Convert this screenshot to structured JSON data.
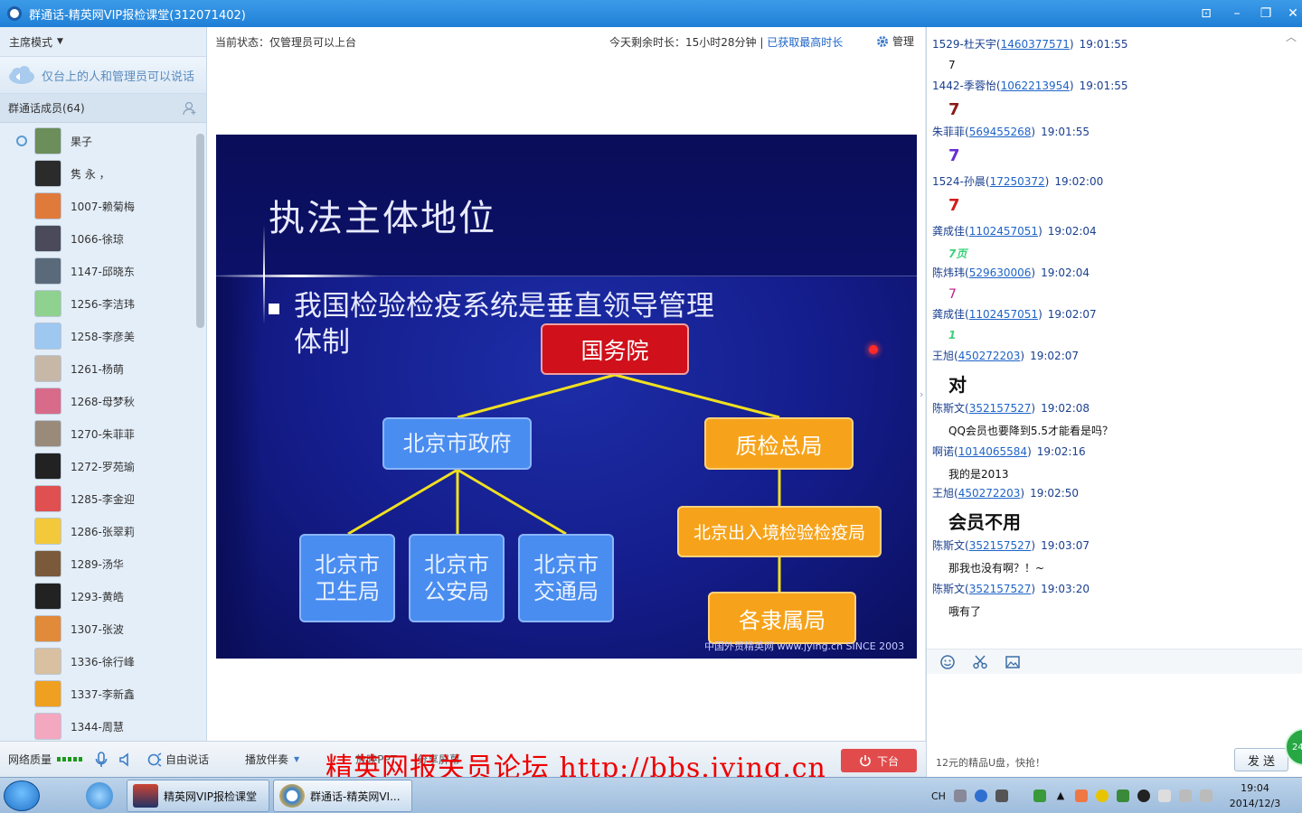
{
  "window": {
    "title": "群通话-精英网VIP报检课堂(312071402)",
    "controls": [
      "⊡",
      "–",
      "❐",
      "✕"
    ]
  },
  "left": {
    "mode_label": "主席模式",
    "notice": "仅台上的人和管理员可以说话",
    "members_header": "群通话成员(64)",
    "members": [
      {
        "name": "果子",
        "color": "#6b8e5a",
        "host": true
      },
      {
        "name": "隽 永 ，",
        "color": "#2b2b2b",
        "host": false
      },
      {
        "name": "1007-赖菊梅",
        "color": "#e07a3a",
        "host": false
      },
      {
        "name": "1066-徐琼",
        "color": "#4a4a5a",
        "host": false
      },
      {
        "name": "1147-邱晓东",
        "color": "#5a6a7a",
        "host": false
      },
      {
        "name": "1256-李洁玮",
        "color": "#8fd18f",
        "host": false
      },
      {
        "name": "1258-李彦美",
        "color": "#9ec8f0",
        "host": false
      },
      {
        "name": "1261-杨萌",
        "color": "#c7b7a7",
        "host": false
      },
      {
        "name": "1268-母梦秋",
        "color": "#d86a8a",
        "host": false
      },
      {
        "name": "1270-朱菲菲",
        "color": "#9a8a7a",
        "host": false
      },
      {
        "name": "1272-罗苑瑜",
        "color": "#222222",
        "host": false
      },
      {
        "name": "1285-李金迎",
        "color": "#e05050",
        "host": false
      },
      {
        "name": "1286-张翠莉",
        "color": "#f3c83a",
        "host": false
      },
      {
        "name": "1289-汤华",
        "color": "#7a5a3a",
        "host": false
      },
      {
        "name": "1293-黄皓",
        "color": "#222222",
        "host": false
      },
      {
        "name": "1307-张波",
        "color": "#e08a3a",
        "host": false
      },
      {
        "name": "1336-徐行峰",
        "color": "#d8c0a0",
        "host": false
      },
      {
        "name": "1337-李新鑫",
        "color": "#f0a020",
        "host": false
      },
      {
        "name": "1344-周慧",
        "color": "#f4a8c0",
        "host": false
      }
    ]
  },
  "center": {
    "status": "当前状态：仅管理员可以上台",
    "remaining": "今天剩余时长：15小时28分钟 |",
    "remaining_link": "已获取最高时长",
    "manage": "管理",
    "slide": {
      "title": "执法主体地位",
      "bullet": "我国检验检疫系统是垂直领导管理体制",
      "nodes": {
        "root": "国务院",
        "gov": "北京市政府",
        "aqsiq": "质检总局",
        "health": "北京市卫生局",
        "police": "北京市公安局",
        "traffic": "北京市交通局",
        "ciq": "北京出入境检验检疫局",
        "branch": "各隶属局"
      },
      "footer": "中国外贸精英网 www.jying.cn  SINCE 2003"
    }
  },
  "bottom": {
    "network_label": "网络质量",
    "free_talk": "自由说话",
    "music": "播放伴奏",
    "ppt": "放映PPT",
    "share": "分享屏幕",
    "leave": "下台",
    "watermark": "精英网报关员论坛 http://bbs.jying.cn"
  },
  "chat": {
    "messages": [
      {
        "name": "1529-杜天宇",
        "qq": "1460377571",
        "time": "19:01:55",
        "text": "7",
        "size": 12,
        "color": "#111111",
        "bold": false,
        "italic": false
      },
      {
        "name": "1442-季蓉怡",
        "qq": "1062213954",
        "time": "19:01:55",
        "text": "7",
        "size": 18,
        "color": "#8b1a1a",
        "bold": true,
        "italic": false
      },
      {
        "name": "朱菲菲",
        "qq": "569455268",
        "time": "19:01:55",
        "text": "7",
        "size": 18,
        "color": "#6a2bd4",
        "bold": true,
        "italic": false
      },
      {
        "name": "1524-孙晨",
        "qq": "17250372",
        "time": "19:02:00",
        "text": "7",
        "size": 18,
        "color": "#d41a1a",
        "bold": true,
        "italic": false
      },
      {
        "name": "龚成佳",
        "qq": "1102457051",
        "time": "19:02:04",
        "text": "7页",
        "size": 12,
        "color": "#3bd17a",
        "bold": true,
        "italic": true
      },
      {
        "name": "陈炜玮",
        "qq": "529630006",
        "time": "19:02:04",
        "text": "7",
        "size": 14,
        "color": "#c0198a",
        "bold": false,
        "italic": false
      },
      {
        "name": "龚成佳",
        "qq": "1102457051",
        "time": "19:02:07",
        "text": "1",
        "size": 12,
        "color": "#3bd17a",
        "bold": true,
        "italic": true
      },
      {
        "name": "王旭",
        "qq": "450272203",
        "time": "19:02:07",
        "text": "对",
        "size": 20,
        "color": "#111111",
        "bold": true,
        "italic": false
      },
      {
        "name": "陈斯文",
        "qq": "352157527",
        "time": "19:02:08",
        "text": "QQ会员也要降到5.5才能看是吗？",
        "size": 12,
        "color": "#111111",
        "bold": false,
        "italic": false
      },
      {
        "name": "啊诺",
        "qq": "1014065584",
        "time": "19:02:16",
        "text": "我的是2013",
        "size": 12,
        "color": "#111111",
        "bold": false,
        "italic": false
      },
      {
        "name": "王旭",
        "qq": "450272203",
        "time": "19:02:50",
        "text": "会员不用",
        "size": 20,
        "color": "#111111",
        "bold": true,
        "italic": false
      },
      {
        "name": "陈斯文",
        "qq": "352157527",
        "time": "19:03:07",
        "text": "那我也没有啊？！~",
        "size": 12,
        "color": "#111111",
        "bold": false,
        "italic": false
      },
      {
        "name": "陈斯文",
        "qq": "352157527",
        "time": "19:03:20",
        "text": "哦有了",
        "size": 12,
        "color": "#111111",
        "bold": false,
        "italic": false
      }
    ],
    "ad": "12元的精品U盘，快抢！",
    "send": "发 送",
    "badge": "24"
  },
  "taskbar": {
    "apps": [
      "精英网VIP报检课堂",
      "群通话-精英网VI..."
    ],
    "lang": "CH",
    "time": "19:04",
    "date": "2014/12/3"
  }
}
